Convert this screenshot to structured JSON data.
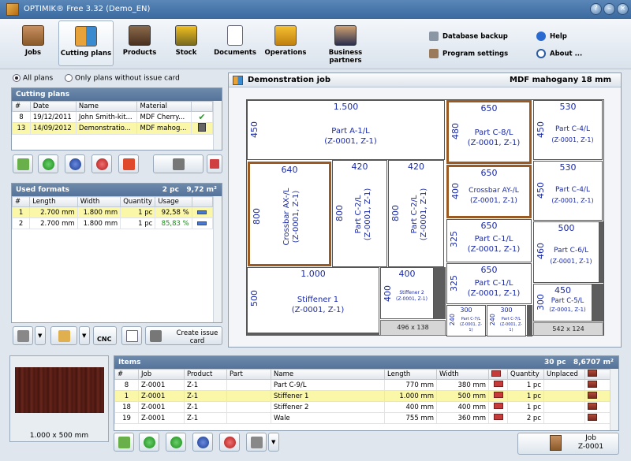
{
  "window": {
    "title": "OPTIMIK® Free 3.32  (Demo_EN)"
  },
  "toolbar": {
    "buttons": [
      {
        "label": "Jobs",
        "icon": "shelf-icon"
      },
      {
        "label": "Cutting plans",
        "icon": "cutting-plan-icon"
      },
      {
        "label": "Products",
        "icon": "products-icon"
      },
      {
        "label": "Stock",
        "icon": "forklift-icon"
      },
      {
        "label": "Documents",
        "icon": "document-icon"
      },
      {
        "label": "Operations",
        "icon": "drill-icon"
      },
      {
        "label": "Business partners",
        "icon": "partners-icon"
      }
    ],
    "right": {
      "database_backup": "Database backup",
      "program_settings": "Program settings",
      "help": "Help",
      "about": "About ..."
    }
  },
  "filter": {
    "all_plans": "All plans",
    "only_without_issue": "Only plans without issue card"
  },
  "cutting_plans": {
    "title": "Cutting plans",
    "columns": [
      "#",
      "Date",
      "Name",
      "Material"
    ],
    "rows": [
      {
        "num": "8",
        "date": "19/12/2011",
        "name": "John Smith-kit...",
        "material": "MDF Cherry..."
      },
      {
        "num": "13",
        "date": "14/09/2012",
        "name": "Demonstratio...",
        "material": "MDF mahog..."
      }
    ]
  },
  "used_formats": {
    "title": "Used formats",
    "summary_pc": "2 pc",
    "summary_area": "9,72 m²",
    "columns": [
      "#",
      "Length",
      "Width",
      "Quantity",
      "Usage"
    ],
    "rows": [
      {
        "num": "1",
        "length": "2.700 mm",
        "width": "1.800 mm",
        "qty": "1 pc",
        "usage": "92,58 %"
      },
      {
        "num": "2",
        "length": "2.700 mm",
        "width": "1.800 mm",
        "qty": "1 pc",
        "usage": "85,83 %"
      }
    ]
  },
  "actions": {
    "cnc": "CNC",
    "create_issue_card": "Create issue card"
  },
  "plan": {
    "title": "Demonstration job",
    "material": "MDF mahogany 18 mm",
    "parts": [
      {
        "w": "1.500",
        "h": "450",
        "name": "Part A-1/L",
        "code": "(Z-0001, Z-1)"
      },
      {
        "w": "650",
        "h": "480",
        "name": "Part C-8/L",
        "code": "(Z-0001, Z-1)"
      },
      {
        "w": "530",
        "h": "450",
        "name": "Part C-4/L",
        "code": "(Z-0001, Z-1)"
      },
      {
        "w": "640",
        "h": "800",
        "name": "Crossbar AX-/L",
        "code": "(Z-0001, Z-1)"
      },
      {
        "w": "420",
        "h": "800",
        "name": "Part C-2/L",
        "code": "(Z-0001, Z-1)"
      },
      {
        "w": "420",
        "h": "800",
        "name": "Part C-2/L",
        "code": "(Z-0001, Z-1)"
      },
      {
        "w": "650",
        "h": "400",
        "name": "Crossbar AY-/L",
        "code": "(Z-0001, Z-1)"
      },
      {
        "w": "530",
        "h": "450",
        "name": "Part C-4/L",
        "code": "(Z-0001, Z-1)"
      },
      {
        "w": "650",
        "h": "325",
        "name": "Part C-1/L",
        "code": "(Z-0001, Z-1)"
      },
      {
        "w": "500",
        "h": "460",
        "name": "Part C-6/L",
        "code": "(Z-0001, Z-1)"
      },
      {
        "w": "1.000",
        "h": "500",
        "name": "Stiffener 1",
        "code": "(Z-0001, Z-1)"
      },
      {
        "w": "400",
        "h": "400",
        "name": "Stiffener 2",
        "code": "(Z-0001, Z-1)"
      },
      {
        "w": "650",
        "h": "325",
        "name": "Part C-1/L",
        "code": "(Z-0001, Z-1)"
      },
      {
        "w": "450",
        "h": "300",
        "name": "Part C-5/L",
        "code": "(Z-0001, Z-1)"
      },
      {
        "w": "300",
        "h": "240",
        "name": "Part C-7/L",
        "code": "(Z-0001, Z-1)"
      },
      {
        "w": "300",
        "h": "240",
        "name": "Part C-7/L",
        "code": "(Z-0001, Z-1)"
      }
    ],
    "offcuts": [
      "496 x 138",
      "542 x 124"
    ]
  },
  "material_preview": {
    "size": "1.000 x 500 mm"
  },
  "items": {
    "title": "Items",
    "summary_pc": "30 pc",
    "summary_area": "8,6707 m²",
    "columns": [
      "#",
      "Job",
      "Product",
      "Part",
      "Name",
      "Length",
      "Width",
      "",
      "Quantity",
      "Unplaced"
    ],
    "rows": [
      {
        "num": "8",
        "job": "Z-0001",
        "product": "Z-1",
        "part": "",
        "name": "Part C-9/L",
        "length": "770 mm",
        "width": "380 mm",
        "qty": "1 pc"
      },
      {
        "num": "1",
        "job": "Z-0001",
        "product": "Z-1",
        "part": "",
        "name": "Stiffener 1",
        "length": "1.000 mm",
        "width": "500 mm",
        "qty": "1 pc"
      },
      {
        "num": "18",
        "job": "Z-0001",
        "product": "Z-1",
        "part": "",
        "name": "Stiffener 2",
        "length": "400 mm",
        "width": "400 mm",
        "qty": "1 pc"
      },
      {
        "num": "19",
        "job": "Z-0001",
        "product": "Z-1",
        "part": "",
        "name": "Wale",
        "length": "755 mm",
        "width": "360 mm",
        "qty": "2 pc"
      }
    ]
  },
  "job_button": {
    "label": "Job",
    "value": "Z-0001"
  }
}
